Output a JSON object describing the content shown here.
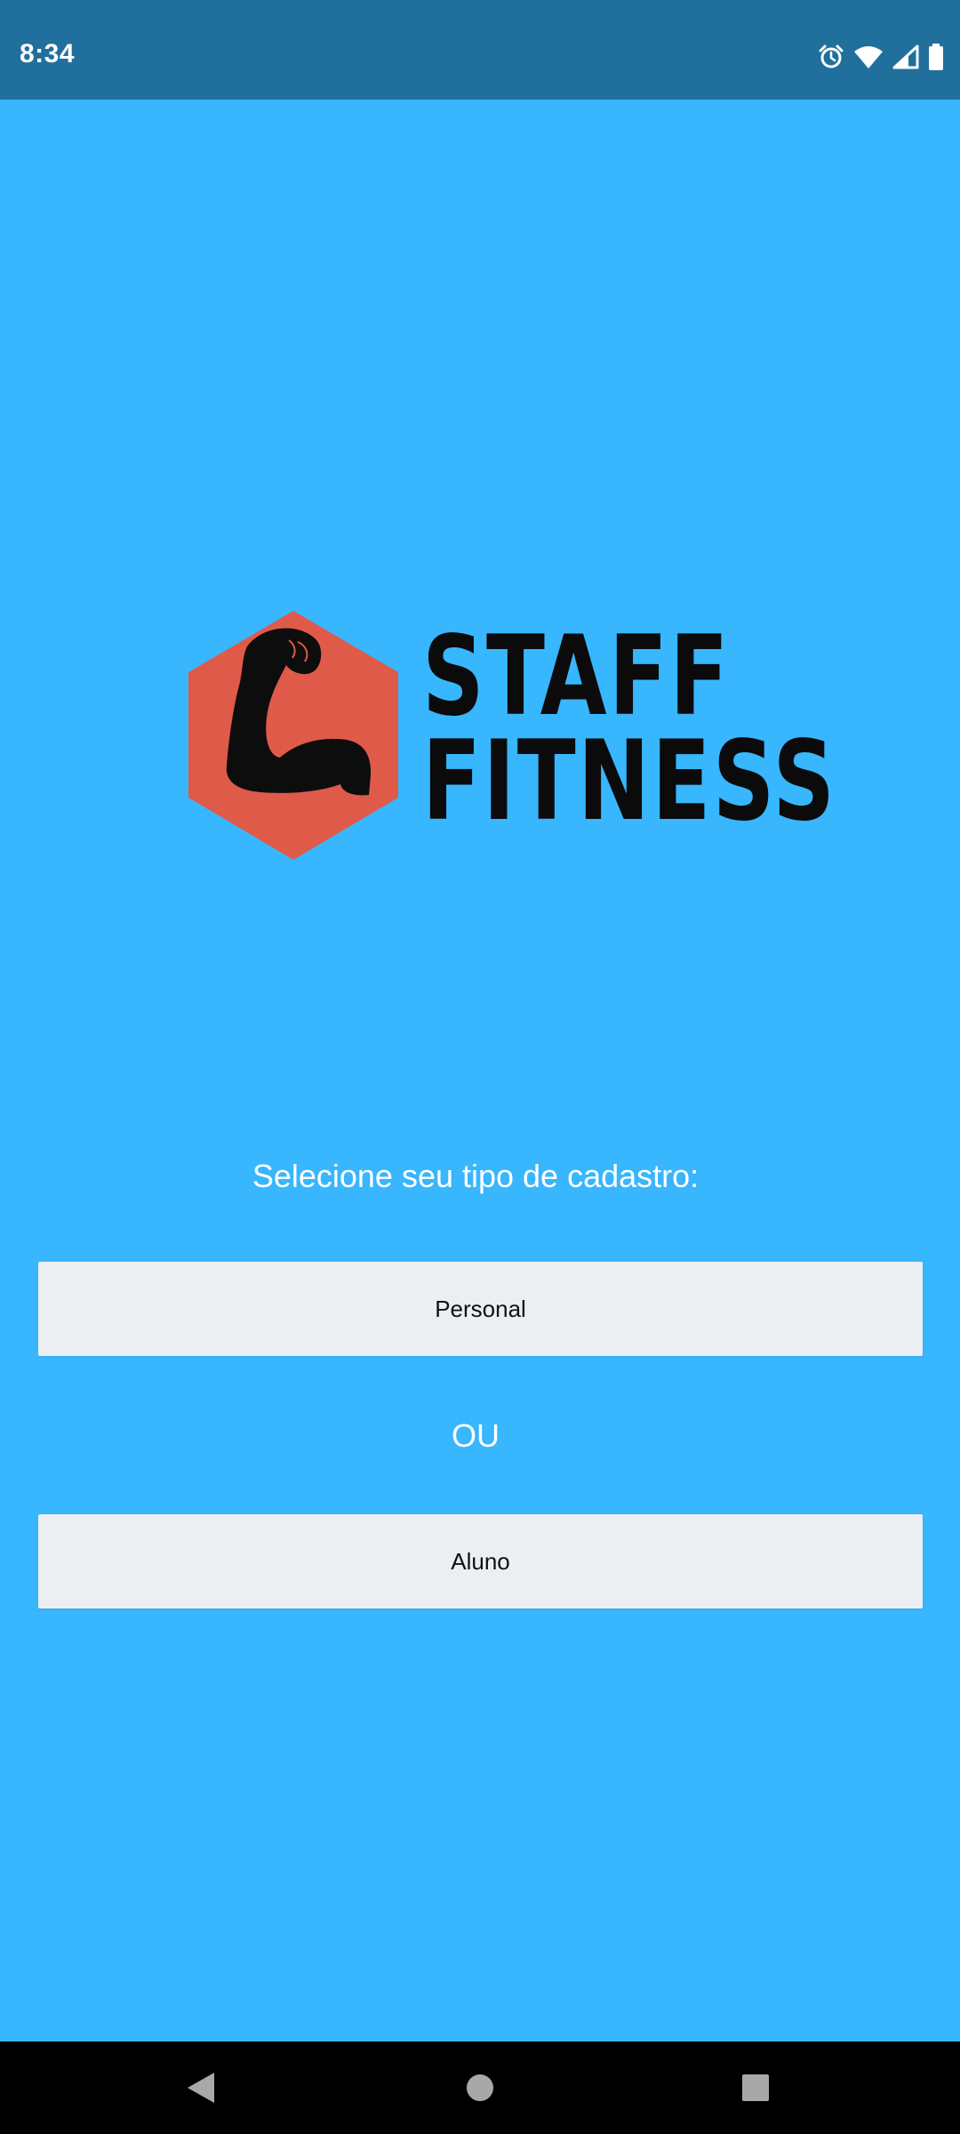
{
  "status_bar": {
    "time": "8:34",
    "icons": [
      "alarm-icon",
      "wifi-icon",
      "signal-icon",
      "battery-icon"
    ]
  },
  "logo": {
    "line1": "STAFF",
    "line2": "FITNESS",
    "hex_color": "#e05a4a",
    "text_color": "#0b0b0b"
  },
  "main": {
    "prompt": "Selecione seu tipo de cadastro:",
    "personal_button": "Personal",
    "or_label": "OU",
    "aluno_button": "Aluno"
  },
  "nav_bar": {
    "buttons": [
      "back-icon",
      "home-icon",
      "recents-icon"
    ]
  },
  "colors": {
    "background": "#38b6fe",
    "status_bar": "#216f9c",
    "button_bg": "#eceff1",
    "nav_bar": "#000000"
  }
}
